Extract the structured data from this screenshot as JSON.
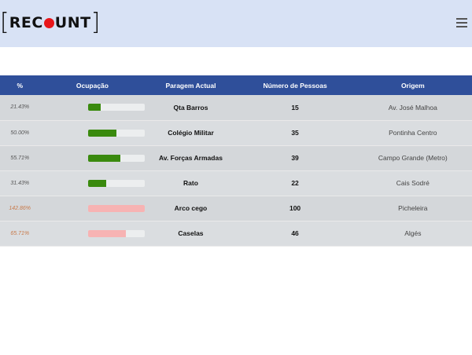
{
  "header": {
    "logo_left": "[",
    "logo_text_1": "REC",
    "logo_text_2": "UNT",
    "logo_right": "]"
  },
  "table": {
    "columns": [
      "%",
      "Ocupação",
      "Paragem Actual",
      "Número de Pessoas",
      "Origem"
    ],
    "rows": [
      {
        "percent": "21.43%",
        "occupancy": 0.2143,
        "stop": "Qta Barros",
        "people": "15",
        "origin": "Av. José Malhoa",
        "over": false
      },
      {
        "percent": "50.00%",
        "occupancy": 0.5,
        "stop": "Colégio Militar",
        "people": "35",
        "origin": "Pontinha Centro",
        "over": false
      },
      {
        "percent": "55.71%",
        "occupancy": 0.5571,
        "stop": "Av. Forças Armadas",
        "people": "39",
        "origin": "Campo Grande (Metro)",
        "over": false
      },
      {
        "percent": "31.43%",
        "occupancy": 0.3143,
        "stop": "Rato",
        "people": "22",
        "origin": "Cais Sodré",
        "over": false
      },
      {
        "percent": "142.86%",
        "occupancy": 1.4286,
        "stop": "Arco cego",
        "people": "100",
        "origin": "Picheleira",
        "over": true
      },
      {
        "percent": "65.71%",
        "occupancy": 0.6571,
        "stop": "Caselas",
        "people": "46",
        "origin": "Algés",
        "over": true
      }
    ]
  },
  "colors": {
    "header_bar": "#d8e2f5",
    "table_header": "#2f4f9a",
    "fill_normal": "#3a8a0e",
    "fill_warn": "#f7b3b3",
    "logo_dot": "#e8161a"
  }
}
